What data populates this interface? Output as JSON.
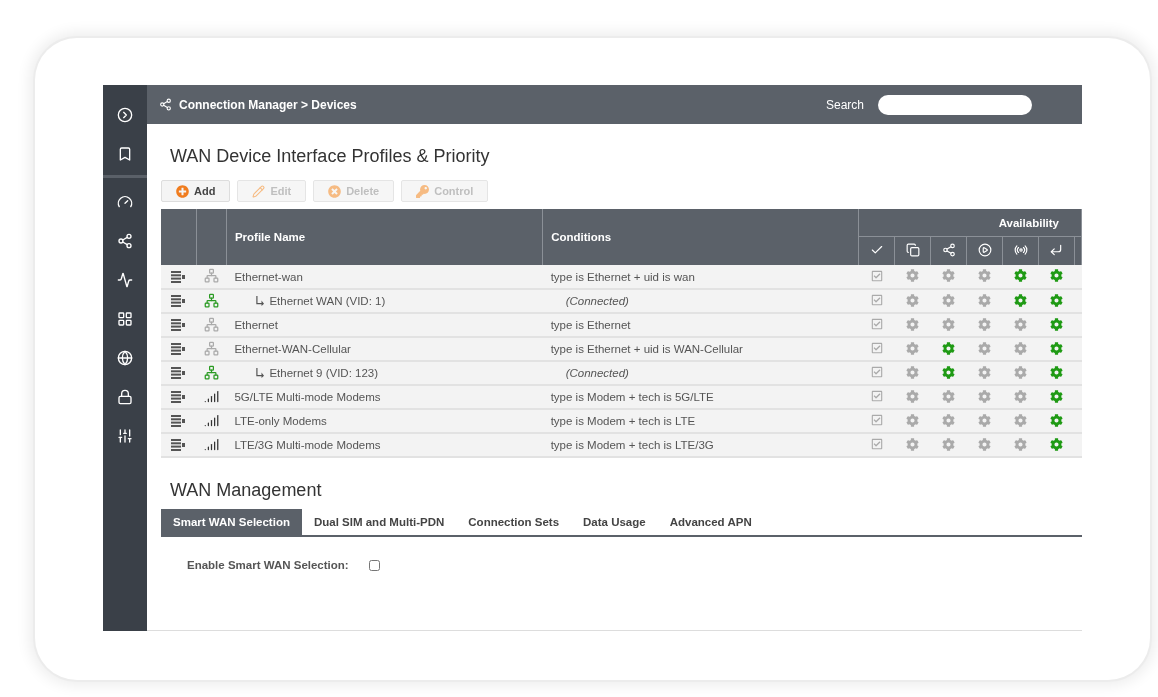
{
  "breadcrumb": "Connection Manager > Devices",
  "search": {
    "label": "Search"
  },
  "page_title": "WAN Device Interface Profiles & Priority",
  "toolbar": [
    {
      "kind": "add",
      "label": "Add",
      "disabled": false
    },
    {
      "kind": "edit",
      "label": "Edit",
      "disabled": true
    },
    {
      "kind": "delete",
      "label": "Delete",
      "disabled": true
    },
    {
      "kind": "control",
      "label": "Control",
      "disabled": true
    }
  ],
  "table": {
    "columns": [
      "Profile Name",
      "Conditions"
    ],
    "availability_header": "Availability",
    "rows": [
      {
        "kind": "profile",
        "device": {
          "kind": "ethernet",
          "connected": false
        },
        "name": "Ethernet-wan",
        "conditions": "type is Ethernet + uid is wan",
        "enabled": true,
        "availability": [
          false,
          false,
          false,
          true,
          true
        ]
      },
      {
        "kind": "connection",
        "device": {
          "kind": "ethernet",
          "connected": true
        },
        "name": "Ethernet WAN (VID: 1)",
        "conditions": "(Connected)",
        "enabled": true,
        "availability": [
          false,
          false,
          false,
          true,
          true
        ]
      },
      {
        "kind": "profile",
        "device": {
          "kind": "ethernet",
          "connected": false
        },
        "name": "Ethernet",
        "conditions": "type is Ethernet",
        "enabled": true,
        "availability": [
          false,
          false,
          false,
          false,
          true
        ]
      },
      {
        "kind": "profile",
        "device": {
          "kind": "ethernet",
          "connected": false
        },
        "name": "Ethernet-WAN-Cellular",
        "conditions": "type is Ethernet + uid is WAN-Cellular",
        "enabled": true,
        "availability": [
          false,
          true,
          false,
          false,
          true
        ]
      },
      {
        "kind": "connection",
        "device": {
          "kind": "ethernet",
          "connected": true
        },
        "name": "Ethernet 9 (VID: 123)",
        "conditions": "(Connected)",
        "enabled": true,
        "availability": [
          false,
          true,
          false,
          false,
          true
        ]
      },
      {
        "kind": "profile",
        "device": {
          "kind": "modem"
        },
        "name": "5G/LTE Multi-mode Modems",
        "conditions": "type is Modem + tech is 5G/LTE",
        "enabled": true,
        "availability": [
          false,
          false,
          false,
          false,
          true
        ]
      },
      {
        "kind": "profile",
        "device": {
          "kind": "modem"
        },
        "name": "LTE-only Modems",
        "conditions": "type is Modem + tech is LTE",
        "enabled": true,
        "availability": [
          false,
          false,
          false,
          false,
          true
        ]
      },
      {
        "kind": "profile",
        "device": {
          "kind": "modem"
        },
        "name": "LTE/3G Multi-mode Modems",
        "conditions": "type is Modem + tech is LTE/3G",
        "enabled": true,
        "availability": [
          false,
          false,
          false,
          false,
          true
        ]
      }
    ]
  },
  "management": {
    "title": "WAN Management",
    "tabs": [
      {
        "label": "Smart WAN Selection",
        "selected": true
      },
      {
        "label": "Dual SIM and Multi-PDN",
        "selected": false
      },
      {
        "label": "Connection Sets",
        "selected": false
      },
      {
        "label": "Data Usage",
        "selected": false
      },
      {
        "label": "Advanced APN",
        "selected": false
      }
    ],
    "field": {
      "label": "Enable Smart WAN Selection:",
      "checked": false
    }
  }
}
